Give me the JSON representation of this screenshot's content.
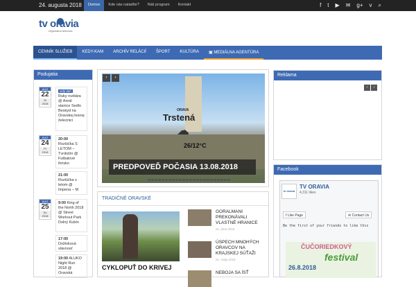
{
  "topbar": {
    "date": "24. augusta 2018",
    "nav": [
      "Domov",
      "Kde nás naladíte?",
      "Náš program",
      "Kontakt"
    ],
    "social_icons": [
      "facebook-icon",
      "twitter-icon",
      "youtube-icon",
      "email-icon",
      "google-plus-icon",
      "vimeo-icon",
      "search-icon"
    ]
  },
  "logo": {
    "text": "tv oravia",
    "subtitle": "regionálna televízia"
  },
  "mainnav": [
    "CENNÍK SLUŽIEB",
    "KEDY-KAM",
    "ARCHÍV RELÁCIÍ",
    "ŠPORT",
    "KULTÚRA",
    "MEDIÁLNA AGENTÚRA"
  ],
  "events": {
    "header": "Podujatia",
    "items": [
      {
        "month": "AUG",
        "day": "22",
        "weekday": "St",
        "year": "2018",
        "tag": "celý deň",
        "text": "Ruky rozbára @ Areál stanice Sedlo Beskyd na Oravskej lesnej železnici"
      },
      {
        "month": "AUG",
        "day": "24",
        "weekday": "Pi",
        "year": "2018",
        "time": "20:00",
        "text": "Rozlúčka S LETOM – Tvrdošín @ Futbalové ihrisko"
      },
      {
        "time": "21:00",
        "text": "Rozlúčka s letom @ Impena – M"
      },
      {
        "month": "AUG",
        "day": "25",
        "weekday": "So",
        "year": "2018",
        "time": "9:00",
        "text": "King of the North 2018 @ Street Workout Park Dolný Kubín"
      },
      {
        "time": "17:00",
        "text": "Dožinková slávnosť"
      },
      {
        "time": "19:00",
        "text": "ALUKO Night Run 2018 @ Oravská"
      }
    ]
  },
  "slider": {
    "location_small": "ORAVA",
    "town": "Trstená",
    "temperature": "26/12°C",
    "caption": "PREDPOVEĎ POČASIA 13.08.2018"
  },
  "section": {
    "title": "TRADIČNÉ ORAVSKÉ",
    "featured_title": "CYKLOPUŤ DO KRIVEJ",
    "items": [
      {
        "title": "GORALMANI PREKONÁVALI VLASTNÉ HRANICE",
        "date": "21. júna 2018"
      },
      {
        "title": "ÚSPECH MNOHÝCH ORAVCOV NA KRAJSKEJ SÚŤAŽI",
        "date": "21. mája 2018"
      },
      {
        "title": "NEBOJA SA ÍSŤ",
        "date": ""
      }
    ]
  },
  "reklama": {
    "header": "Reklama"
  },
  "facebook": {
    "header": "Facebook",
    "page_name": "TV ORAVIA",
    "likes": "4,311 likes",
    "like_button": "Like Page",
    "contact_button": "Contact Us",
    "prompt": "Be the first of your friends to like this",
    "poster_line1": "ČUČORIEDKOVÝ",
    "poster_line2": "festival",
    "poster_line3": "26.8.2018"
  }
}
